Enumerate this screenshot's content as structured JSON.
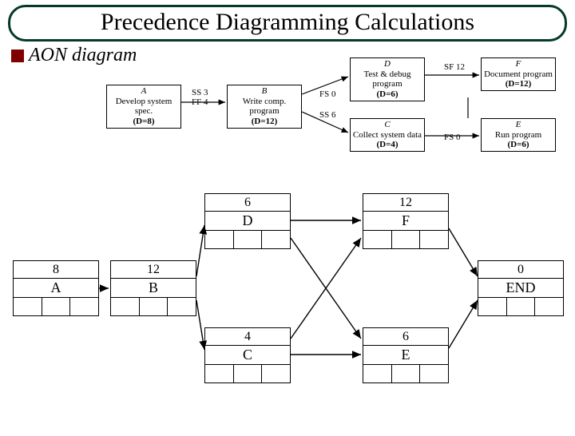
{
  "title": "Precedence Diagramming Calculations",
  "bullet": "AON diagram",
  "activities": {
    "A": {
      "id": "A",
      "desc": "Develop system spec.",
      "dur": "(D=8)"
    },
    "B": {
      "id": "B",
      "desc": "Write comp. program",
      "dur": "(D=12)"
    },
    "C": {
      "id": "C",
      "desc": "Collect system data",
      "dur": "(D=4)"
    },
    "D": {
      "id": "D",
      "desc": "Test & debug program",
      "dur": "(D=6)"
    },
    "E": {
      "id": "E",
      "desc": "Run program",
      "dur": "(D=6)"
    },
    "F": {
      "id": "F",
      "desc": "Document program",
      "dur": "(D=12)"
    }
  },
  "links": {
    "ab": "SS 3\nFF 4",
    "bd_fs0": "FS 0",
    "bc_ss6": "SS 6",
    "df_sf12": "SF 12",
    "ce_fs0": "FS 0"
  },
  "nodes": {
    "A": {
      "dur": "8",
      "label": "A"
    },
    "B": {
      "dur": "12",
      "label": "B"
    },
    "D": {
      "dur": "6",
      "label": "D"
    },
    "F": {
      "dur": "12",
      "label": "F"
    },
    "C": {
      "dur": "4",
      "label": "C"
    },
    "E": {
      "dur": "6",
      "label": "E"
    },
    "END": {
      "dur": "0",
      "label": "END"
    }
  }
}
